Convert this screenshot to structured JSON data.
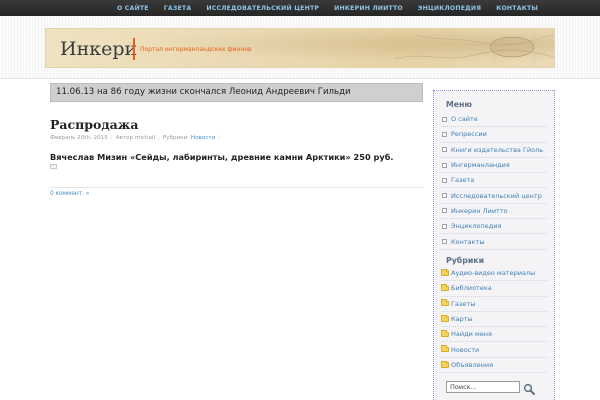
{
  "topnav": {
    "items": [
      "О САЙТЕ",
      "ГАЗЕТА",
      "ИССЛЕДОВАТЕЛЬСКИЙ ЦЕНТР",
      "ИНКЕРИН ЛИИТТО",
      "ЭНЦИКЛОПЕДИЯ",
      "КОНТАКТЫ"
    ]
  },
  "header": {
    "site_title": "Инкери",
    "tagline": "Портал ингерманландских финнов"
  },
  "ticker": {
    "text": "11.06.13 на 86 году жизни скончался Леонид Андреевич Гильди"
  },
  "post": {
    "title": "Распродажа",
    "date": "Февраль 20th, 2015",
    "author": "Автор michail",
    "rubrics_label": "Рубрики:",
    "rubric": "Новости",
    "body": "Вячеслав Мизин «Сейды, лабиринты, древние камни Арктики» 250 руб.",
    "comments": "0 коммент. »"
  },
  "sidebar": {
    "menu_title": "Меню",
    "menu_items": [
      "О сайте",
      "Репрессии",
      "Книги издательства Гйоль",
      "Ингерманландия",
      "Газета",
      "Исследовательский центр",
      "Инкерин Лиитто",
      "Энциклопедия",
      "Контакты"
    ],
    "rubrics_title": "Рубрики",
    "rubric_items": [
      "Аудио-видео материалы",
      "Библиотека",
      "Газеты",
      "Карты",
      "Найди меня",
      "Новости",
      "Объявления"
    ],
    "search_value": "Поиск..."
  },
  "colors": {
    "accent": "#e8601c",
    "link": "#3f7fb6",
    "nav_link": "#8ec5e8"
  },
  "icons": {
    "search": "magnifier-icon",
    "rubric": "folder-icon"
  }
}
